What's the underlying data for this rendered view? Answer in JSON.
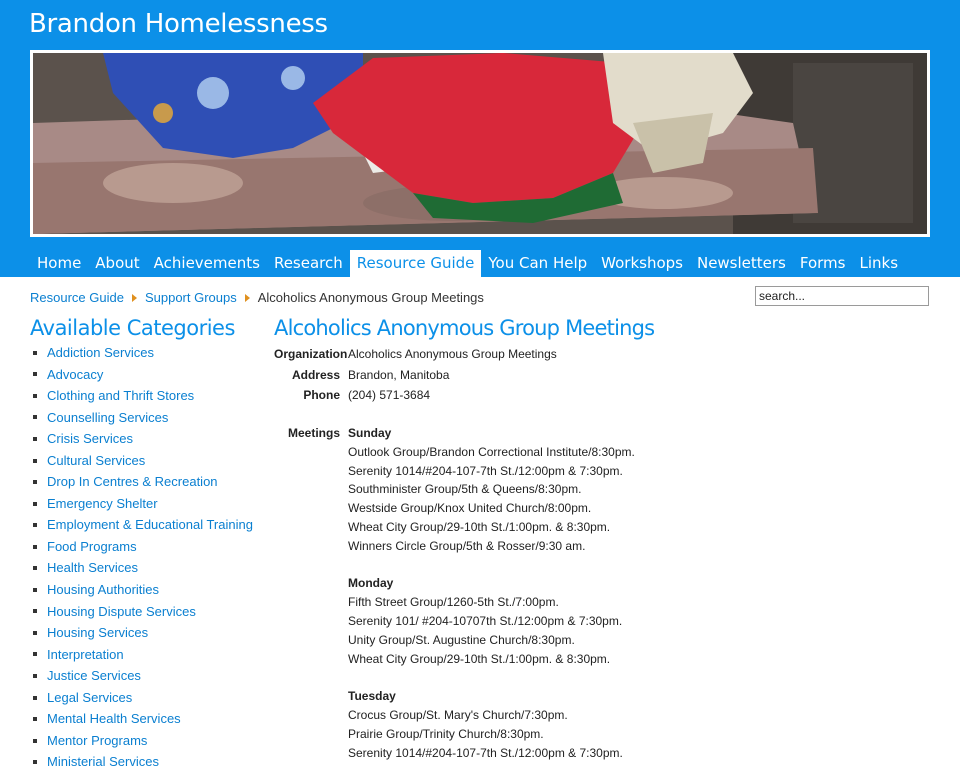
{
  "site": {
    "title": "Brandon Homelessness"
  },
  "nav": {
    "items": [
      {
        "label": "Home"
      },
      {
        "label": "About"
      },
      {
        "label": "Achievements"
      },
      {
        "label": "Research"
      },
      {
        "label": "Resource Guide",
        "active": true
      },
      {
        "label": "You Can Help"
      },
      {
        "label": "Workshops"
      },
      {
        "label": "Newsletters"
      },
      {
        "label": "Forms"
      },
      {
        "label": "Links"
      }
    ]
  },
  "breadcrumb": {
    "items": [
      "Resource Guide",
      "Support Groups"
    ],
    "current": "Alcoholics Anonymous Group Meetings"
  },
  "search": {
    "placeholder": "search..."
  },
  "sidebar": {
    "title": "Available Categories",
    "categories": [
      "Addiction Services",
      "Advocacy",
      "Clothing and Thrift Stores",
      "Counselling Services",
      "Crisis Services",
      "Cultural Services",
      "Drop In Centres & Recreation",
      "Emergency Shelter",
      "Employment & Educational Training",
      "Food Programs",
      "Health Services",
      "Housing Authorities",
      "Housing Dispute Services",
      "Housing Services",
      "Interpretation",
      "Justice Services",
      "Legal Services",
      "Mental Health Services",
      "Mentor Programs",
      "Ministerial Services"
    ]
  },
  "content": {
    "title": "Alcoholics Anonymous Group Meetings",
    "organization_label": "Organization",
    "organization": "Alcoholics Anonymous Group Meetings",
    "address_label": "Address",
    "address": "Brandon, Manitoba",
    "phone_label": "Phone",
    "phone": "(204) 571-3684",
    "meetings_label": "Meetings",
    "days": [
      {
        "day": "Sunday",
        "meetings": [
          "Outlook Group/Brandon Correctional Institute/8:30pm.",
          "Serenity 1014/#204-107-7th St./12:00pm & 7:30pm.",
          "Southminister Group/5th & Queens/8:30pm.",
          "Westside Group/Knox United Church/8:00pm.",
          "Wheat City Group/29-10th St./1:00pm. & 8:30pm.",
          "Winners Circle Group/5th & Rosser/9:30 am."
        ]
      },
      {
        "day": "Monday",
        "meetings": [
          "Fifth Street Group/1260-5th St./7:00pm.",
          "Serenity 101/ #204-10707th St./12:00pm & 7:30pm.",
          "Unity Group/St. Augustine Church/8:30pm.",
          "Wheat City Group/29-10th St./1:00pm. & 8:30pm."
        ]
      },
      {
        "day": "Tuesday",
        "meetings": [
          "Crocus Group/St. Mary's Church/7:30pm.",
          "Prairie Group/Trinity Church/8:30pm.",
          "Serenity 1014/#204-107-7th St./12:00pm & 7:30pm."
        ]
      }
    ]
  },
  "colors": {
    "brand": "#0c90e8",
    "link": "#0a7fd0",
    "crumb_arrow": "#e0901e"
  }
}
